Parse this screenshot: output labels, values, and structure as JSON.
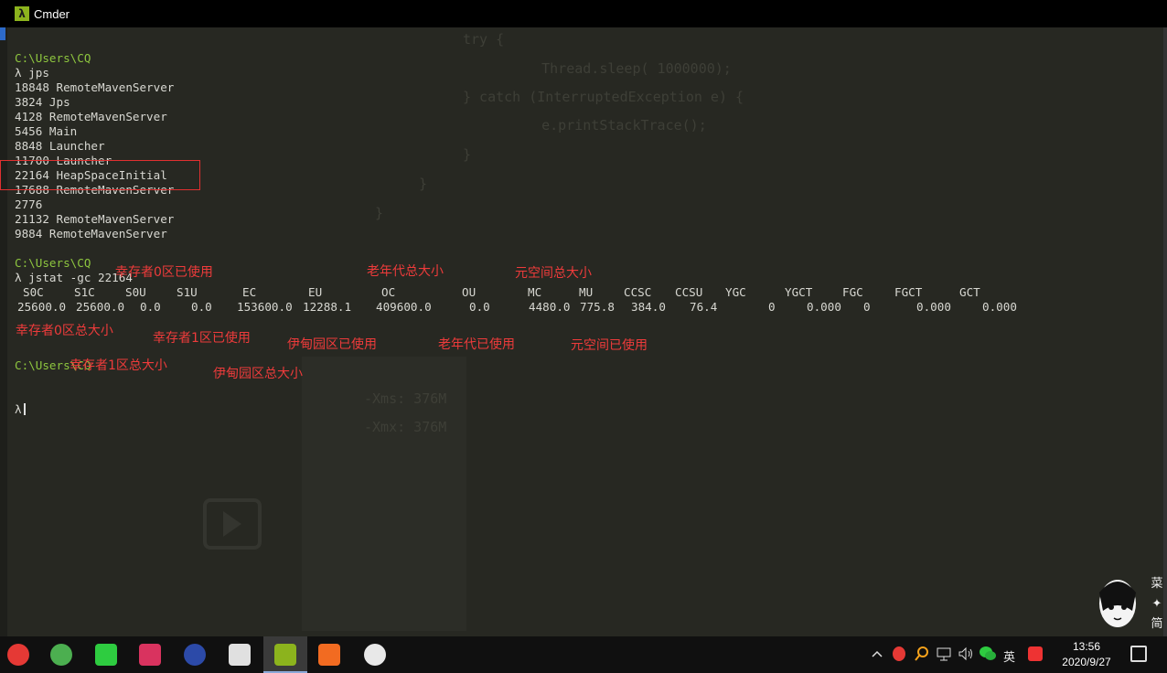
{
  "window": {
    "title": "Cmder"
  },
  "terminal": {
    "lines": [
      {
        "text": "C:\\Users\\CQ",
        "kind": "path"
      },
      {
        "text": "λ jps",
        "kind": "cmd"
      },
      {
        "text": "18848 RemoteMavenServer",
        "kind": "out"
      },
      {
        "text": "3824 Jps",
        "kind": "out"
      },
      {
        "text": "4128 RemoteMavenServer",
        "kind": "out"
      },
      {
        "text": "5456 Main",
        "kind": "out"
      },
      {
        "text": "8848 Launcher",
        "kind": "out"
      },
      {
        "text": "11700 Launcher",
        "kind": "out"
      },
      {
        "text": "22164 HeapSpaceInitial",
        "kind": "out"
      },
      {
        "text": "17688 RemoteMavenServer",
        "kind": "out"
      },
      {
        "text": "2776",
        "kind": "out"
      },
      {
        "text": "21132 RemoteMavenServer",
        "kind": "out"
      },
      {
        "text": "9884 RemoteMavenServer",
        "kind": "out"
      },
      {
        "text": "",
        "kind": "blank"
      },
      {
        "text": "C:\\Users\\CQ",
        "kind": "path"
      },
      {
        "text": "λ jstat -gc 22164",
        "kind": "cmd"
      }
    ],
    "jstat_headers": [
      "S0C",
      "S1C",
      "S0U",
      "S1U",
      "EC",
      "EU",
      "OC",
      "OU",
      "MC",
      "MU",
      "CCSC",
      "CCSU",
      "YGC",
      "YGCT",
      "FGC",
      "FGCT",
      "GCT"
    ],
    "jstat_values": [
      "25600.0",
      "25600.0",
      "0.0",
      "0.0",
      "153600.0",
      "12288.1",
      "409600.0",
      "0.0",
      "4480.0",
      "775.8",
      "384.0",
      "76.4",
      "0",
      "0.000",
      "0",
      "0.000",
      "0.000"
    ],
    "prompt_path": "C:\\Users\\CQ",
    "prompt_symbol": "λ"
  },
  "annotations": {
    "s0u": "幸存者0区已使用",
    "oc": "老年代总大小",
    "mc": "元空间总大小",
    "s0c": "幸存者0区总大小",
    "s1u": "幸存者1区已使用",
    "eu": "伊甸园区已使用",
    "ou": "老年代已使用",
    "mu": "元空间已使用",
    "s1c": "幸存者1区总大小",
    "ec": "伊甸园区总大小"
  },
  "background_code": {
    "lines": [
      "try {",
      "    Thread.sleep( 1000000);",
      "} catch (InterruptedException e) {",
      "    e.printStackTrace();",
      "}",
      "}",
      "}"
    ],
    "xms": "-Xms: 376M",
    "xmx": "-Xmx: 376M"
  },
  "taskbar": {
    "apps": [
      {
        "name": "qq",
        "color": "#e53935"
      },
      {
        "name": "chrome",
        "color": "#4caf50"
      },
      {
        "name": "wechat",
        "color": "#2ecc40"
      },
      {
        "name": "intellij",
        "color": "#d9335f"
      },
      {
        "name": "eclipse",
        "color": "#2c4aa8"
      },
      {
        "name": "typora",
        "color": "#e0e0e0"
      },
      {
        "name": "cmder",
        "color": "#8cb31d"
      },
      {
        "name": "app-orange",
        "color": "#f26b21"
      },
      {
        "name": "settings",
        "color": "#e8e8e8"
      }
    ],
    "ime_label": "英",
    "clock_time": "13:56",
    "clock_date": "2020/9/27"
  }
}
